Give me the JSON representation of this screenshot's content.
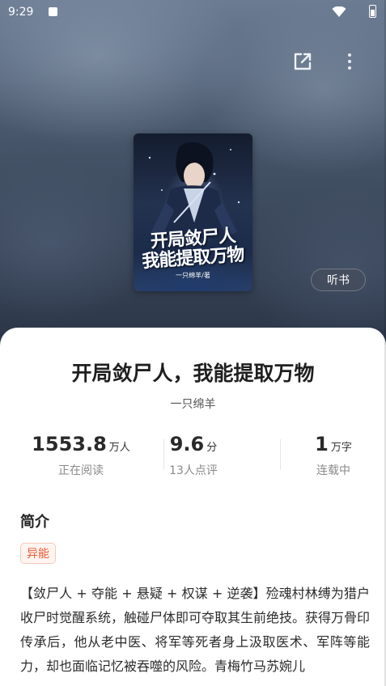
{
  "status_bar": {
    "time": "9:29"
  },
  "book": {
    "title": "开局敛尸人，我能提取万物",
    "author": "一只绵羊",
    "cover": {
      "title_line1": "开局敛尸人",
      "title_line2": "我能提取万物",
      "author_text": "一只绵羊/著"
    }
  },
  "actions": {
    "listen_label": "听书"
  },
  "stats": [
    {
      "value": "1553.8",
      "unit": "万人",
      "label": "正在阅读"
    },
    {
      "value": "9.6",
      "unit": "分",
      "label": "13人点评"
    },
    {
      "value": "1",
      "unit": "万字",
      "label": "连载中"
    }
  ],
  "intro": {
    "heading": "简介",
    "tag": "异能",
    "text": "【敛尸人 + 夺能 + 悬疑 + 权谋 + 逆袭】殓魂村林缚为猎户收尸时觉醒系统，触碰尸体即可夺取其生前绝技。获得万骨印传承后，他从老中医、将军等死者身上汲取医术、军阵等能力，却也面临记忆被吞噬的风险。青梅竹马苏婉儿"
  },
  "icons": {
    "share": "share-external-icon",
    "more": "more-vertical-icon",
    "wifi": "wifi-icon",
    "battery": "battery-icon"
  },
  "colors": {
    "tag_text": "#ea5a35",
    "tag_border": "#f6c9bd",
    "title_text": "#1f1f1f"
  }
}
